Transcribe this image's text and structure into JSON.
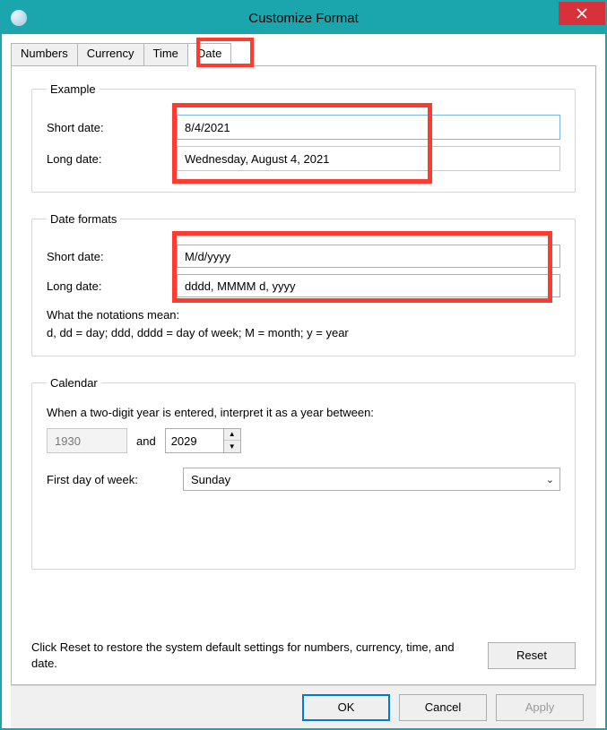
{
  "window": {
    "title": "Customize Format"
  },
  "tabs": {
    "numbers": "Numbers",
    "currency": "Currency",
    "time": "Time",
    "date": "Date"
  },
  "example": {
    "legend": "Example",
    "short_label": "Short date:",
    "short_value": "8/4/2021",
    "long_label": "Long date:",
    "long_value": "Wednesday, August 4, 2021"
  },
  "formats": {
    "legend": "Date formats",
    "short_label": "Short date:",
    "short_value": "M/d/yyyy",
    "long_label": "Long date:",
    "long_value": "dddd, MMMM d, yyyy",
    "notation_title": "What the notations mean:",
    "notation_body": "d, dd = day;  ddd, dddd = day of week;  M = month;  y = year"
  },
  "calendar": {
    "legend": "Calendar",
    "two_digit_text": "When a two-digit year is entered, interpret it as a year between:",
    "year_start": "1930",
    "and_text": "and",
    "year_end": "2029",
    "first_day_label": "First day of week:",
    "first_day_value": "Sunday"
  },
  "reset": {
    "text": "Click Reset to restore the system default settings for numbers, currency, time, and date.",
    "button": "Reset"
  },
  "footer": {
    "ok": "OK",
    "cancel": "Cancel",
    "apply": "Apply"
  }
}
